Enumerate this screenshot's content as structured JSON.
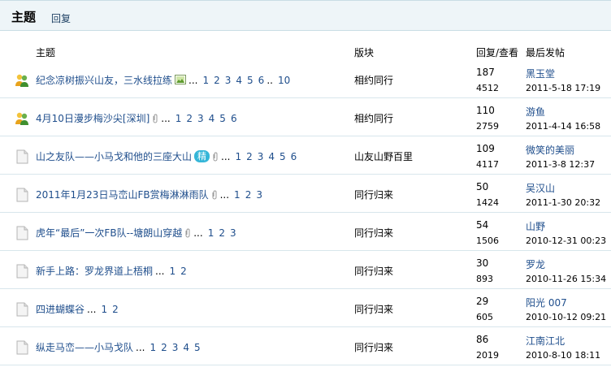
{
  "tabs": {
    "active": "主题",
    "reply": "回复"
  },
  "columns": {
    "topic": "主题",
    "forum": "版块",
    "stats": "回复/查看",
    "last": "最后发帖"
  },
  "rows": [
    {
      "icon": "users-icon",
      "title": "纪念凉树振兴山友，三水线拉练",
      "image_icon": true,
      "clip": false,
      "badge": "",
      "pages": [
        "1",
        "2",
        "3",
        "4",
        "5",
        "6"
      ],
      "pages_tail": "10",
      "forum": "相约同行",
      "replies": "187",
      "views": "4512",
      "last_user": "黑玉堂",
      "last_time": "2011-5-18 17:19"
    },
    {
      "icon": "users-icon",
      "title": "4月10日漫步梅沙尖[深圳]",
      "image_icon": false,
      "clip": true,
      "badge": "",
      "pages": [
        "1",
        "2",
        "3",
        "4",
        "5",
        "6"
      ],
      "pages_tail": "",
      "forum": "相约同行",
      "replies": "110",
      "views": "2759",
      "last_user": "游鱼",
      "last_time": "2011-4-14 16:58"
    },
    {
      "icon": "page-icon",
      "title": "山之友队——小马戈和他的三座大山",
      "image_icon": false,
      "clip": true,
      "badge": "精",
      "pages": [
        "1",
        "2",
        "3",
        "4",
        "5",
        "6"
      ],
      "pages_tail": "",
      "forum": "山友山野百里",
      "replies": "109",
      "views": "4117",
      "last_user": "微笑的美丽",
      "last_time": "2011-3-8 12:37"
    },
    {
      "icon": "page-icon",
      "title": "2011年1月23日马峦山FB赏梅淋淋雨队",
      "image_icon": false,
      "clip": true,
      "badge": "",
      "pages": [
        "1",
        "2",
        "3"
      ],
      "pages_tail": "",
      "forum": "同行归来",
      "replies": "50",
      "views": "1424",
      "last_user": "吴汉山",
      "last_time": "2011-1-30 20:32"
    },
    {
      "icon": "page-icon",
      "title": "虎年“最后”一次FB队--塘朗山穿越",
      "image_icon": false,
      "clip": true,
      "badge": "",
      "pages": [
        "1",
        "2",
        "3"
      ],
      "pages_tail": "",
      "forum": "同行归来",
      "replies": "54",
      "views": "1506",
      "last_user": "山野",
      "last_time": "2010-12-31 00:23"
    },
    {
      "icon": "page-icon",
      "title": "新手上路：罗龙界道上梧桐",
      "image_icon": false,
      "clip": false,
      "badge": "",
      "pages": [
        "1",
        "2"
      ],
      "pages_tail": "",
      "forum": "同行归来",
      "replies": "30",
      "views": "893",
      "last_user": "罗龙",
      "last_time": "2010-11-26 15:34"
    },
    {
      "icon": "page-icon",
      "title": "四进蝴蝶谷",
      "image_icon": false,
      "clip": false,
      "badge": "",
      "pages": [
        "1",
        "2"
      ],
      "pages_tail": "",
      "forum": "同行归来",
      "replies": "29",
      "views": "605",
      "last_user": "阳光 007",
      "last_time": "2010-10-12 09:21"
    },
    {
      "icon": "page-icon",
      "title": "纵走马峦——小马戈队",
      "image_icon": false,
      "clip": false,
      "badge": "",
      "pages": [
        "1",
        "2",
        "3",
        "4",
        "5"
      ],
      "pages_tail": "",
      "forum": "同行归来",
      "replies": "86",
      "views": "2019",
      "last_user": "江南江北",
      "last_time": "2010-8-10 18:11"
    }
  ]
}
